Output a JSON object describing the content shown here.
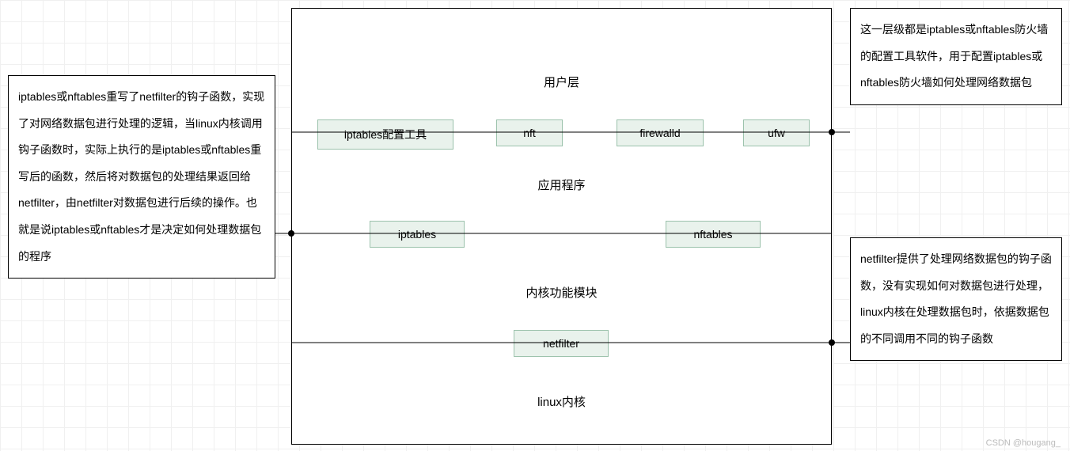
{
  "notes": {
    "left": "iptables或nftables重写了netfilter的钩子函数，实现了对网络数据包进行处理的逻辑，当linux内核调用钩子函数时，实际上执行的是iptables或nftables重写后的函数，然后将对数据包的处理结果返回给netfilter，由netfilter对数据包进行后续的操作。也就是说iptables或nftables才是决定如何处理数据包的程序",
    "top_right": "这一层级都是iptables或nftables防火墙的配置工具软件，用于配置iptables或nftables防火墙如何处理网络数据包",
    "bottom_right": "netfilter提供了处理网络数据包的钩子函数，没有实现如何对数据包进行处理，linux内核在处理数据包时，依据数据包的不同调用不同的钩子函数"
  },
  "layers": {
    "user": "用户层",
    "app": "应用程序",
    "kernel_module": "内核功能模块",
    "kernel": "linux内核"
  },
  "nodes": {
    "iptables_tool": "iptables配置工具",
    "nft": "nft",
    "firewalld": "firewalld",
    "ufw": "ufw",
    "iptables": "iptables",
    "nftables": "nftables",
    "netfilter": "netfilter"
  },
  "watermark": "CSDN @hougang_"
}
